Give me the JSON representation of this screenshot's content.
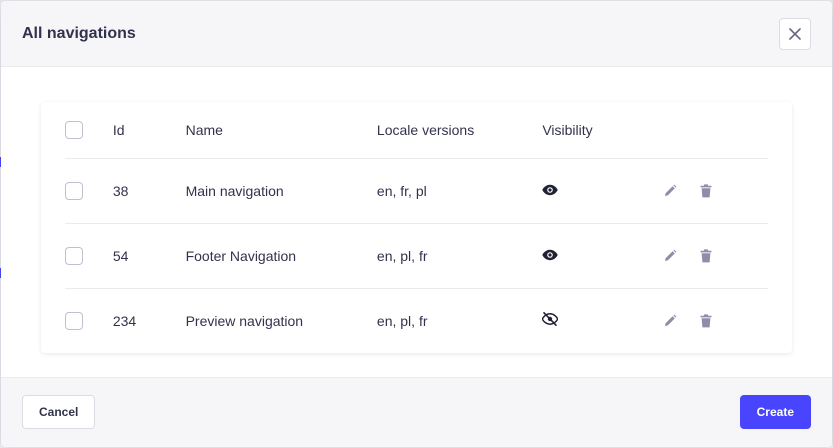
{
  "modal": {
    "title": "All navigations",
    "close_icon": "close-icon"
  },
  "table": {
    "headers": {
      "id": "Id",
      "name": "Name",
      "locale": "Locale versions",
      "visibility": "Visibility"
    },
    "rows": [
      {
        "id": "38",
        "name": "Main navigation",
        "locales": "en, fr, pl",
        "visible": true
      },
      {
        "id": "54",
        "name": "Footer Navigation",
        "locales": "en, pl, fr",
        "visible": true
      },
      {
        "id": "234",
        "name": "Preview navigation",
        "locales": "en, pl, fr",
        "visible": false
      }
    ]
  },
  "footer": {
    "cancel_label": "Cancel",
    "create_label": "Create"
  },
  "colors": {
    "accent": "#4945ff",
    "icon": "#8e8ea9",
    "text": "#32324d"
  }
}
